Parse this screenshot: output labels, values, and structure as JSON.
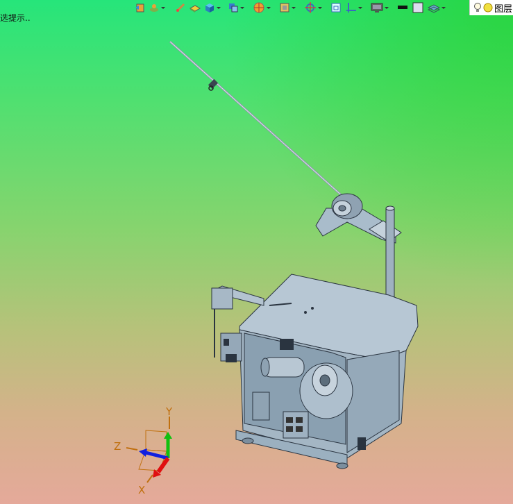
{
  "status": {
    "hint_text": "选提示.."
  },
  "toolbar": {
    "buttons": [
      {
        "name": "view-restore-icon",
        "has_menu": false
      },
      {
        "name": "snap-view-icon",
        "has_menu": true
      },
      {
        "name": "edit-section-icon",
        "has_menu": false
      },
      {
        "name": "shade-with-edges-icon",
        "has_menu": false
      },
      {
        "name": "render-style-icon",
        "has_menu": true
      },
      {
        "name": "view-orientation-icon",
        "has_menu": true
      },
      {
        "name": "wcs-display-icon",
        "has_menu": true
      },
      {
        "name": "fit-view-icon",
        "has_menu": true
      },
      {
        "name": "rotate-view-icon",
        "has_menu": true
      },
      {
        "name": "layout-icon",
        "has_menu": false
      },
      {
        "name": "clip-section-icon",
        "has_menu": true
      },
      {
        "name": "display-monitor-icon",
        "has_menu": true
      },
      {
        "name": "background-dark-icon",
        "has_menu": false
      },
      {
        "name": "background-light-icon",
        "has_menu": false
      },
      {
        "name": "layer-settings-icon",
        "has_menu": true
      }
    ],
    "layer_label": "图层"
  },
  "triad": {
    "x_label": "X",
    "y_label": "Y",
    "z_label": "Z",
    "colors": {
      "x": "#e01010",
      "y": "#10c010",
      "z": "#1020e0",
      "ortho": "#c07010"
    }
  },
  "colors": {
    "model_body": "#a9bccb",
    "model_edge": "#2a3440"
  }
}
